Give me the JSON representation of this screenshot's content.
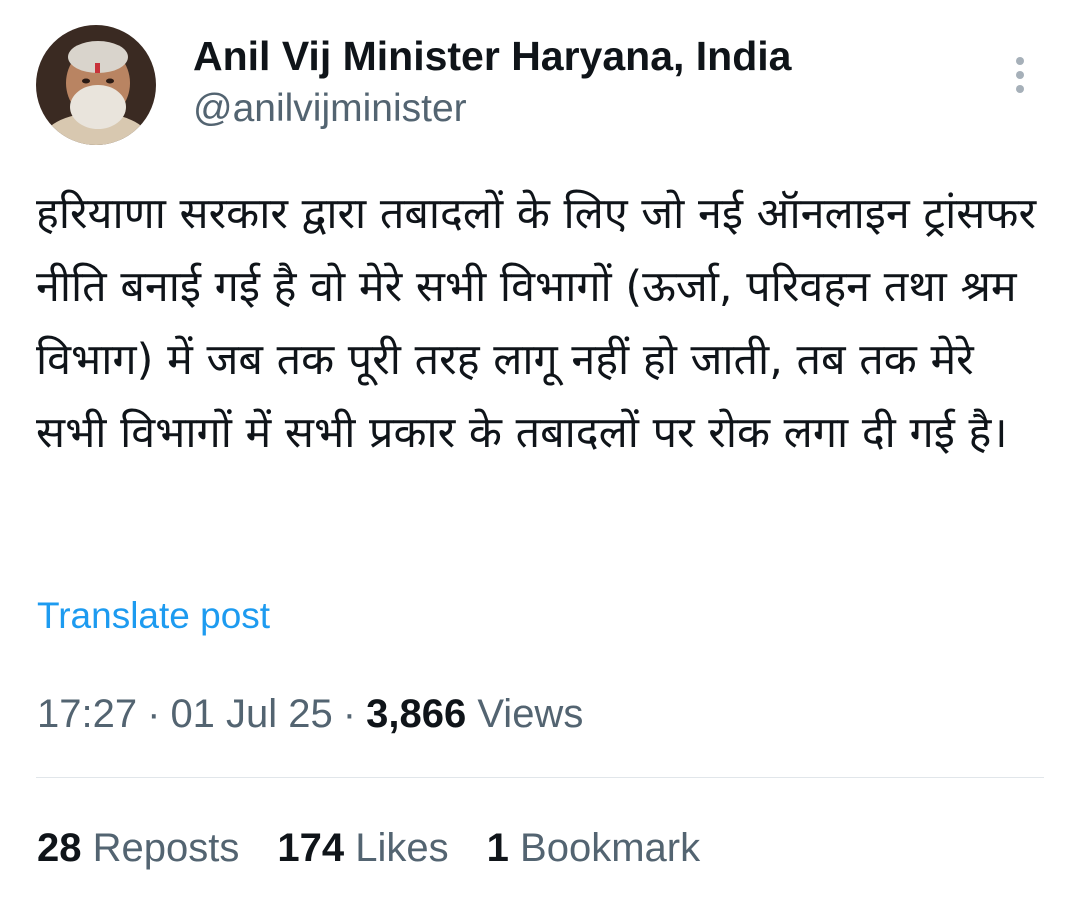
{
  "author": {
    "name": "Anil Vij Minister Haryana, India",
    "handle": "@anilvijminister",
    "avatar_icon": "profile-photo"
  },
  "more_icon": "more-vertical-icon",
  "post": {
    "text": "हरियाणा सरकार द्वारा तबादलों के लिए जो नई ऑनलाइन ट्रांसफर नीति बनाई गई है वो मेरे सभी विभागों (ऊर्जा, परिवहन तथा श्रम विभाग) में जब तक पूरी तरह लागू नहीं हो जाती, तब तक मेरे सभी विभागों में सभी प्रकार के तबादलों पर रोक लगा दी गई है।",
    "translate_label": "Translate post"
  },
  "meta": {
    "time": "17:27",
    "date": "01 Jul 25",
    "separator": "·",
    "views_count": "3,866",
    "views_label": "Views"
  },
  "stats": {
    "reposts_count": "28",
    "reposts_label": "Reposts",
    "likes_count": "174",
    "likes_label": "Likes",
    "bookmarks_count": "1",
    "bookmarks_label": "Bookmark"
  },
  "colors": {
    "primary_text": "#0f1419",
    "secondary_text": "#536471",
    "link": "#1d9bf0",
    "divider": "#e1e6ea"
  }
}
